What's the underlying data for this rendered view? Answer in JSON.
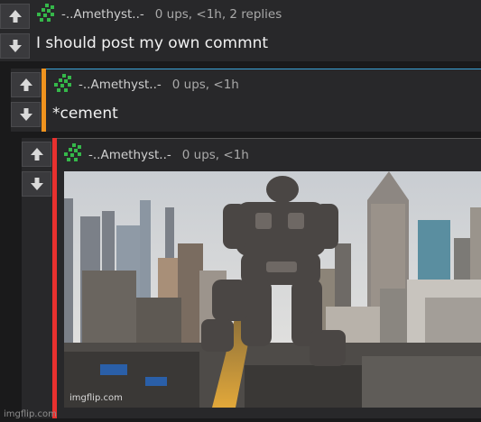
{
  "colors": {
    "background": "#1a1a1b",
    "panel": "#28282a",
    "reply_bar_orange": "#f0931e",
    "reply_bar_red": "#e8312f",
    "accent_line": "#3aa3d8",
    "avatar_green": "#35b84a"
  },
  "comments": [
    {
      "username": "-..Amethyst..-",
      "stats": "0 ups, <1h, 2 replies",
      "text": "I should post my own commnt",
      "upvote_icon": "arrow-up-icon",
      "downvote_icon": "arrow-down-icon"
    },
    {
      "username": "-..Amethyst..-",
      "stats": "0 ups, <1h",
      "text": "*cement",
      "upvote_icon": "arrow-up-icon",
      "downvote_icon": "arrow-down-icon"
    },
    {
      "username": "-..Amethyst..-",
      "stats": "0 ups, <1h",
      "image_watermark": "imgflip.com",
      "upvote_icon": "arrow-up-icon",
      "downvote_icon": "arrow-down-icon"
    }
  ],
  "footer_watermark": "imgflip.com"
}
